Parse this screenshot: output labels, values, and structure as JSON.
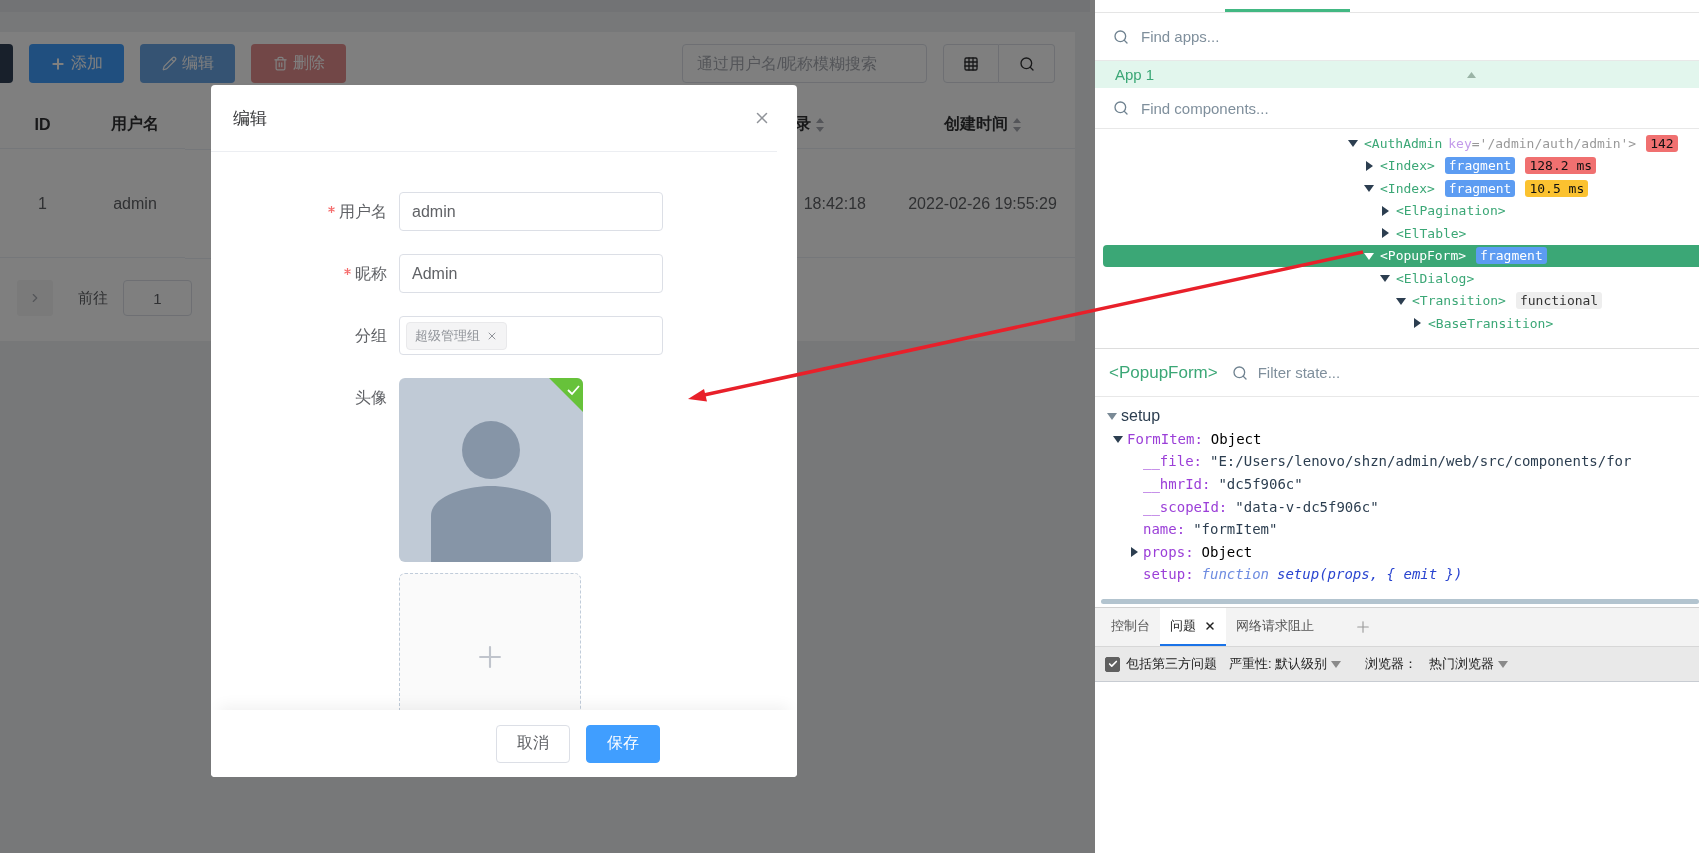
{
  "page": {
    "toolbar": {
      "buttons": [
        {
          "kind": "blank",
          "disabled": false
        },
        {
          "kind": "add",
          "label": "添加",
          "disabled": false
        },
        {
          "kind": "edit",
          "label": "编辑",
          "disabled": true
        },
        {
          "kind": "delete",
          "label": "删除",
          "disabled": true
        }
      ],
      "search": {
        "placeholder": "通过用户名/昵称模糊搜索"
      }
    },
    "table": {
      "columns": [
        {
          "label": "ID",
          "sortable": false
        },
        {
          "label": "用户名",
          "sortable": false
        },
        {
          "label": "录",
          "sortable": true
        },
        {
          "label": "创建时间",
          "sortable": true
        }
      ],
      "rows": [
        [
          "1",
          "admin",
          "18:42:18",
          "2022-02-26 19:55:29"
        ]
      ]
    },
    "pagination": {
      "goto_label": "前往",
      "page": "1"
    }
  },
  "dialog": {
    "title": "编辑",
    "fields": [
      {
        "kind": "text",
        "label": "用户名",
        "required": true,
        "value": "admin"
      },
      {
        "kind": "text",
        "label": "昵称",
        "required": true,
        "value": "Admin"
      },
      {
        "kind": "tags",
        "label": "分组",
        "required": false,
        "tags": [
          "超级管理组"
        ]
      },
      {
        "kind": "avatar",
        "label": "头像",
        "required": false,
        "uploaded": true
      }
    ],
    "buttons": [
      {
        "label": "取消",
        "primary": false
      },
      {
        "label": "保存",
        "primary": true
      }
    ]
  },
  "devtools": {
    "apps_search": {
      "placeholder": "Find apps..."
    },
    "app": {
      "label": "App 1",
      "selected": true
    },
    "components_search": {
      "placeholder": "Find components..."
    },
    "tree": [
      {
        "label": "<AuthAdmin",
        "attr_name": "key",
        "attr_value": "='/admin/auth/admin'>",
        "badges": [
          {
            "kind": "slow",
            "text": "142"
          }
        ],
        "expanded": true,
        "selected": false,
        "children": [
          {
            "label": "<Index>",
            "badges": [
              {
                "kind": "fragment",
                "text": "fragment"
              },
              {
                "kind": "slow",
                "text": "128.2 ms"
              }
            ],
            "expanded": false,
            "selected": false
          },
          {
            "label": "<Index>",
            "badges": [
              {
                "kind": "fragment",
                "text": "fragment"
              },
              {
                "kind": "medium",
                "text": "10.5 ms"
              }
            ],
            "expanded": true,
            "selected": false,
            "children": [
              {
                "label": "<ElPagination>",
                "expanded": false,
                "selected": false
              },
              {
                "label": "<ElTable>",
                "expanded": false,
                "selected": false
              }
            ]
          },
          {
            "label": "<PopupForm>",
            "badges": [
              {
                "kind": "fragment",
                "text": "fragment"
              }
            ],
            "expanded": true,
            "selected": true,
            "children": [
              {
                "label": "<ElDialog>",
                "expanded": true,
                "selected": false,
                "children": [
                  {
                    "label": "<Transition>",
                    "badges": [
                      {
                        "kind": "functional",
                        "text": "functional"
                      }
                    ],
                    "expanded": true,
                    "selected": false,
                    "children": [
                      {
                        "label": "<BaseTransition>",
                        "expanded": false,
                        "selected": false
                      }
                    ]
                  }
                ]
              }
            ]
          }
        ]
      }
    ],
    "inspector": {
      "component": "<PopupForm>",
      "filter": {
        "placeholder": "Filter state..."
      },
      "sections": [
        {
          "label": "setup",
          "expanded": true,
          "items": [
            {
              "key": "FormItem:",
              "kind": "object",
              "value": "Object",
              "expanded": true,
              "children": [
                {
                  "key": "__file:",
                  "kind": "string",
                  "value": "\"E:/Users/lenovo/shzn/admin/web/src/components/for"
                },
                {
                  "key": "__hmrId:",
                  "kind": "string",
                  "value": "\"dc5f906c\""
                },
                {
                  "key": "__scopeId:",
                  "kind": "string",
                  "value": "\"data-v-dc5f906c\""
                },
                {
                  "key": "name:",
                  "kind": "string",
                  "value": "\"formItem\""
                },
                {
                  "key": "props:",
                  "kind": "object",
                  "value": "Object",
                  "expanded": false
                },
                {
                  "key": "setup:",
                  "kind": "function",
                  "keyword": "function",
                  "value": "setup(props, { emit })"
                }
              ]
            }
          ]
        }
      ]
    },
    "drawer": {
      "tabs": [
        {
          "label": "控制台",
          "selected": false,
          "closable": false
        },
        {
          "label": "问题",
          "selected": true,
          "closable": true
        },
        {
          "label": "网络请求阻止",
          "selected": false,
          "closable": false
        }
      ],
      "filters": {
        "third_party": {
          "label": "包括第三方问题",
          "checked": true
        },
        "severity": "严重性: 默认级别",
        "browser_label": "浏览器：",
        "browser": "热门浏览器"
      }
    }
  }
}
